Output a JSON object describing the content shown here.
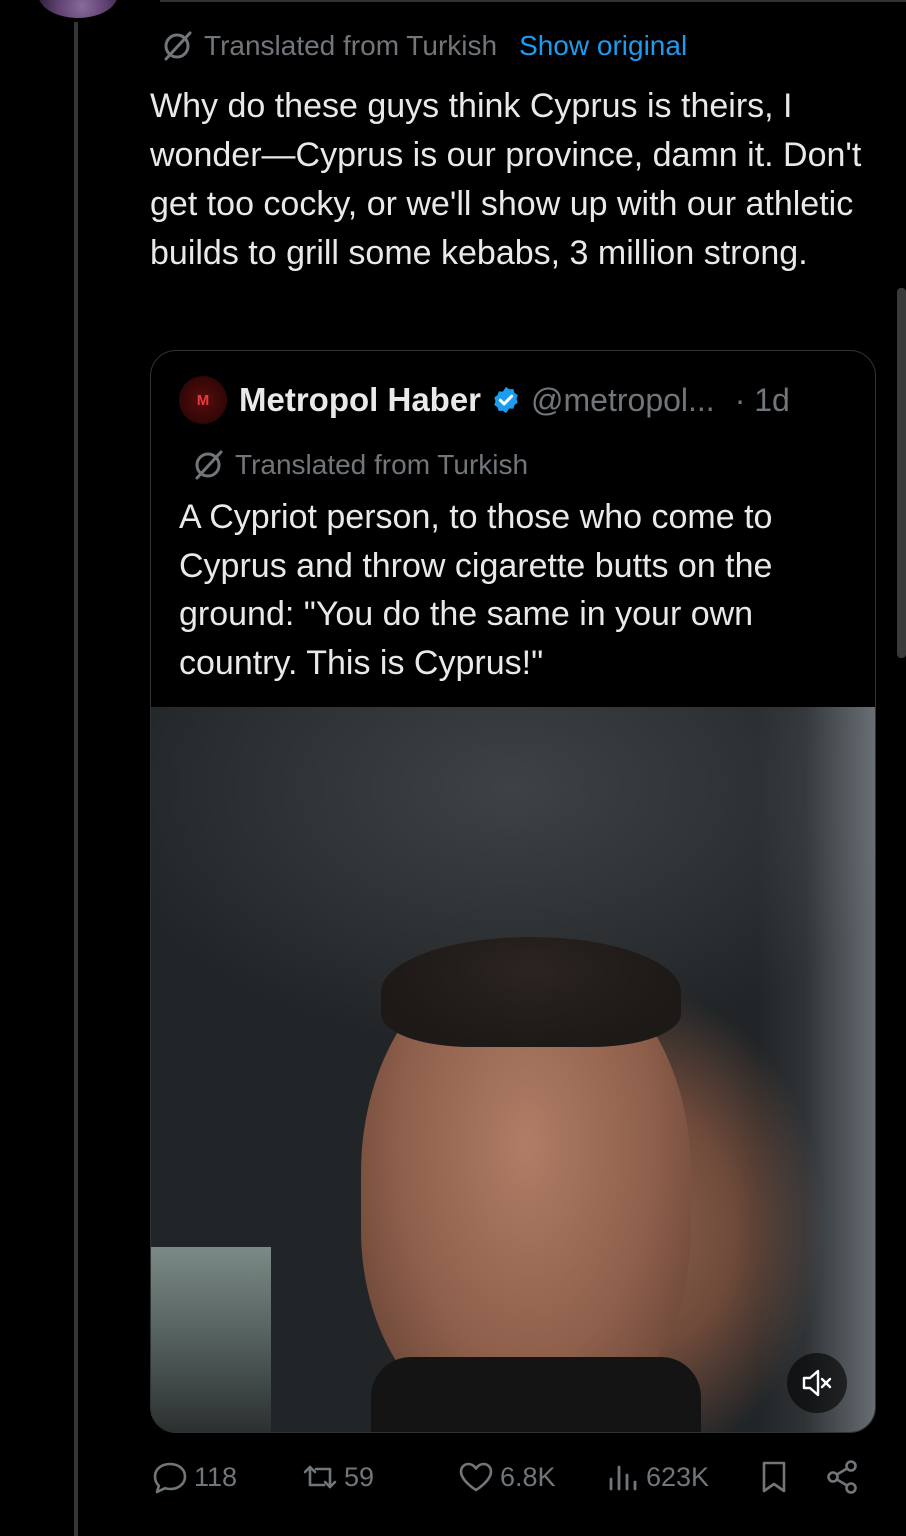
{
  "tweet": {
    "translation_note": "Translated from Turkish",
    "show_original_label": "Show original",
    "text": "Why do these guys think Cyprus is theirs, I wonder—Cyprus is our province, damn it. Don't get too cocky, or we'll show up with our athletic builds to grill some kebabs, 3 million strong."
  },
  "quote": {
    "avatar_letter": "M",
    "name": "Metropol Haber",
    "handle": "@metropol...",
    "time": "· 1d",
    "translation_note": "Translated from Turkish",
    "text": "A Cypriot person, to those who come to Cyprus and throw cigarette butts on the ground: \"You do the same in your own country. This is Cyprus!\"",
    "media": {
      "type": "video",
      "muted": true,
      "icon": "volume-muted-icon"
    }
  },
  "actions": {
    "replies": "118",
    "reposts": "59",
    "likes": "6.8K",
    "views": "623K"
  },
  "colors": {
    "background": "#000000",
    "text": "#e7e9ea",
    "muted": "#71767b",
    "link": "#1d9bf0",
    "verified": "#1d9bf0",
    "border": "#2f3336"
  }
}
